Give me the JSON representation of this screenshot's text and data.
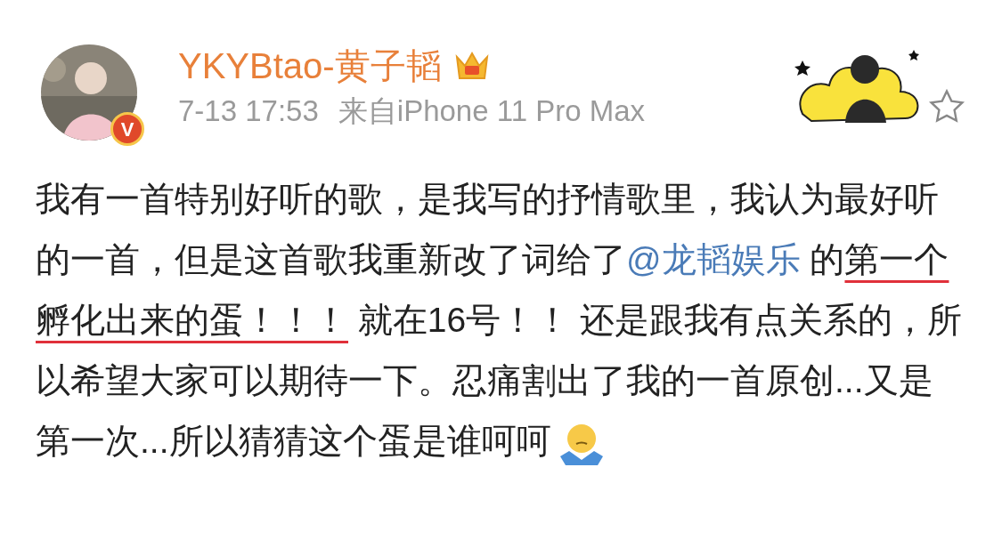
{
  "post": {
    "author": "YKYBtao-黄子韬",
    "verified_badge": "V",
    "time": "7-13 17:53",
    "source": "来自iPhone 11 Pro Max",
    "body": [
      {
        "kind": "text",
        "text": "我有一首特别好听的歌，是我写的抒情歌里，我认为最好听的一首，但是这首歌我重新改了词给了"
      },
      {
        "kind": "mention",
        "text": "@龙韬娱乐"
      },
      {
        "kind": "text",
        "text": " 的"
      },
      {
        "kind": "underlined",
        "text": "第一个孵化出来的蛋！！！"
      },
      {
        "kind": "text",
        "text": " 就在16号！！ 还是跟我有点关系的，所以希望大家可以期待一下。忍痛割出了我的一首原创...又是第一次...所以猜猜这个蛋是谁呵呵"
      }
    ]
  }
}
